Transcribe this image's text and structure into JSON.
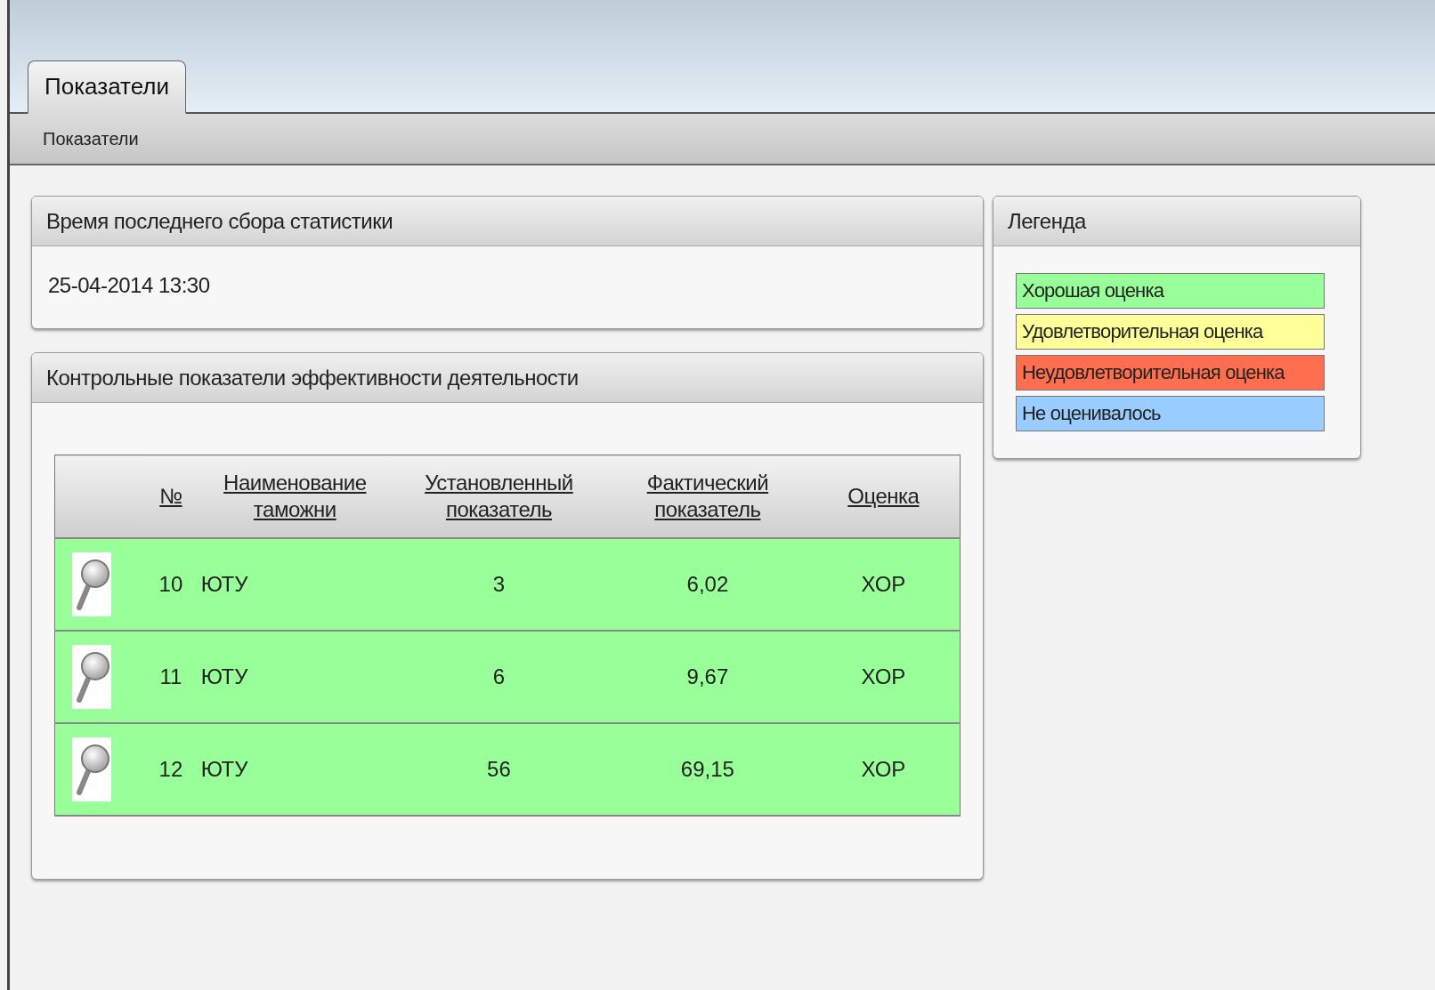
{
  "tabs": [
    {
      "label": "Показатели",
      "selected": true
    }
  ],
  "subnav": {
    "label": "Показатели"
  },
  "stats_panel": {
    "title": "Время последнего сбора статистики",
    "value": "25-04-2014 13:30"
  },
  "kpi_panel": {
    "title": "Контрольные показатели эффективности деятельности",
    "table": {
      "columns": [
        "№",
        "Наименование таможни",
        "Установленный показатель",
        "Фактический показатель",
        "Оценка"
      ],
      "rows": [
        {
          "number": "10",
          "customs": "ЮТУ",
          "target": "3",
          "actual": "6,02",
          "grade": "ХОР",
          "color": "#99ff99"
        },
        {
          "number": "11",
          "customs": "ЮТУ",
          "target": "6",
          "actual": "9,67",
          "grade": "ХОР",
          "color": "#99ff99"
        },
        {
          "number": "12",
          "customs": "ЮТУ",
          "target": "56",
          "actual": "69,15",
          "grade": "ХОР",
          "color": "#99ff99"
        }
      ]
    }
  },
  "legend": {
    "title": "Легенда",
    "items": [
      {
        "label": "Хорошая оценка",
        "color": "#99ff99"
      },
      {
        "label": "Удовлетворительная оценка",
        "color": "#ffff99"
      },
      {
        "label": "Неудовлетворительная оценка",
        "color": "#ff6f4f"
      },
      {
        "label": "Не оценивалось",
        "color": "#99ccff"
      }
    ]
  }
}
